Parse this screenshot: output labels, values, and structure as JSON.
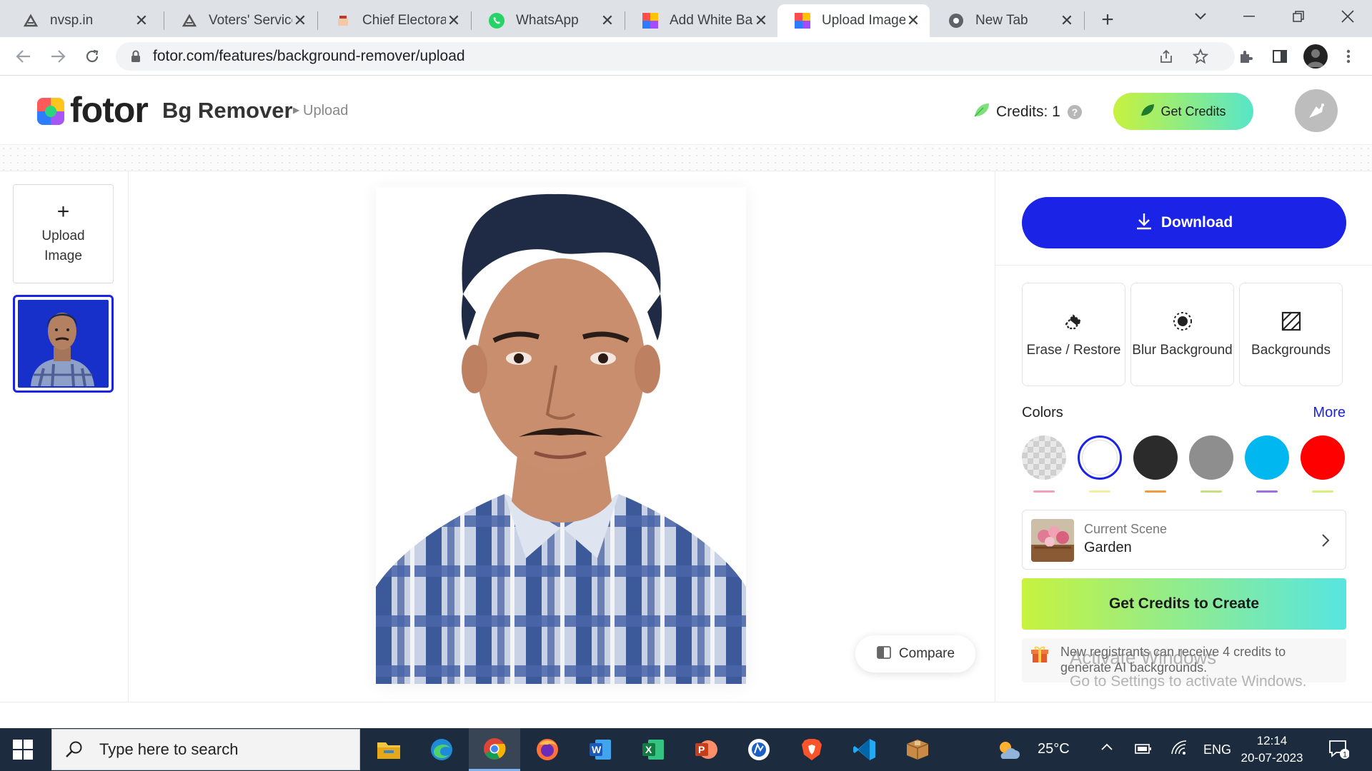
{
  "browser": {
    "tabs": [
      {
        "title": "nvsp.in",
        "icon": "eci-logo-icon"
      },
      {
        "title": "Voters' Services",
        "icon": "eci-logo-icon"
      },
      {
        "title": "Chief Electoral",
        "icon": "ceo-logo-icon"
      },
      {
        "title": "WhatsApp",
        "icon": "whatsapp-icon"
      },
      {
        "title": "Add White Bac",
        "icon": "fotor-icon"
      },
      {
        "title": "Upload Image",
        "icon": "fotor-icon",
        "active": true
      },
      {
        "title": "New Tab",
        "icon": "chrome-icon"
      }
    ],
    "url": "fotor.com/features/background-remover/upload"
  },
  "header": {
    "logo": "fotor",
    "app_name": "Bg Remover",
    "breadcrumb": "Upload",
    "credits_label": "Credits: 1",
    "get_credits_label": "Get Credits"
  },
  "left_rail": {
    "upload_label": "Upload Image"
  },
  "canvas": {
    "compare_label": "Compare"
  },
  "right_panel": {
    "download_label": "Download",
    "tools": [
      {
        "label": "Erase / Restore",
        "icon": "eraser-icon"
      },
      {
        "label": "Blur Background",
        "icon": "blur-icon"
      },
      {
        "label": "Backgrounds",
        "icon": "backgrounds-icon"
      }
    ],
    "colors_title": "Colors",
    "more_label": "More",
    "swatches": [
      {
        "name": "transparent",
        "color": "checker"
      },
      {
        "name": "white",
        "color": "#ffffff",
        "selected": true
      },
      {
        "name": "black",
        "color": "#2b2b2b"
      },
      {
        "name": "gray",
        "color": "#8e8e8e"
      },
      {
        "name": "cyan",
        "color": "#00b7f0"
      },
      {
        "name": "red",
        "color": "#ff0000"
      }
    ],
    "scene": {
      "small_label": "Current Scene",
      "name": "Garden"
    },
    "create_label": "Get Credits to Create",
    "promo_text": "New registrants can receive 4 credits to generate AI backgrounds."
  },
  "watermark": {
    "title": "Activate Windows",
    "subtitle": "Go to Settings to activate Windows."
  },
  "taskbar": {
    "search_placeholder": "Type here to search",
    "temperature": "25°C",
    "language": "ENG",
    "time": "12:14",
    "date": "20-07-2023",
    "notification_count": "1"
  },
  "colors": {
    "brand_blue": "#1a23e6",
    "gradient_start": "#c7f23f",
    "gradient_end": "#57e5c9"
  }
}
